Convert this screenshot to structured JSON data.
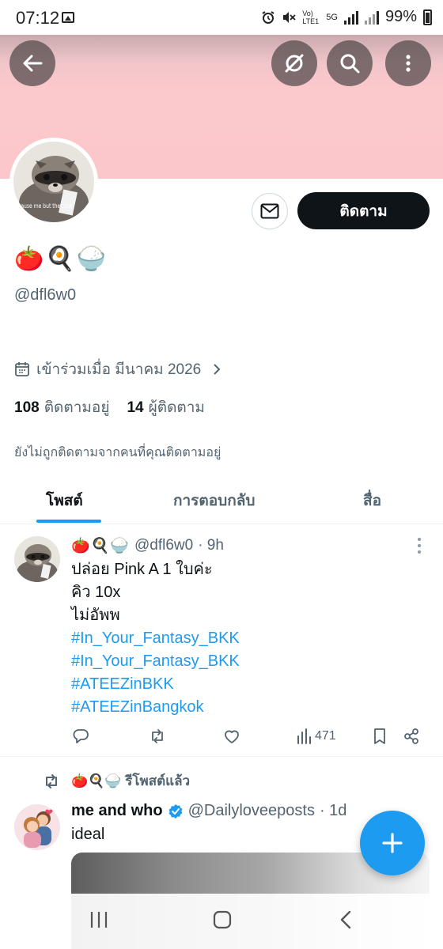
{
  "status_bar": {
    "time": "07:12",
    "network": "Vo) LTE1",
    "network_gen": "5G",
    "battery": "99%"
  },
  "profile": {
    "display_name": "🍅🍳🍚",
    "handle": "@dfl6w0",
    "joined": "เข้าร่วมเมื่อ มีนาคม 2026",
    "following_count": "108",
    "following_label": "ติดตามอยู่",
    "followers_count": "14",
    "followers_label": "ผู้ติดตาม",
    "not_followed_note": "ยังไม่ถูกติดตามจากคนที่คุณติดตามอยู่",
    "follow_button": "ติดตาม",
    "avatar_caption": "cause me but the fuck"
  },
  "tabs": [
    {
      "label": "โพสต์",
      "active": true
    },
    {
      "label": "การตอบกลับ",
      "active": false
    },
    {
      "label": "สื่อ",
      "active": false
    }
  ],
  "post": {
    "author": "🍅🍳🍚",
    "handle": "@dfl6w0",
    "time": "· 9h",
    "lines": [
      "ปล่อย Pink A 1 ใบค่ะ",
      "คิว 10x",
      "ไม่อัพพ"
    ],
    "hashtags": [
      "#In_Your_Fantasy_BKK",
      "#In_Your_Fantasy_BKK",
      "#ATEEZinBKK",
      "#ATEEZinBangkok"
    ],
    "views": "471"
  },
  "repost": {
    "label": "🍅🍳🍚 รีโพสต์แล้ว",
    "author": "me and who",
    "handle": "@Dailyloveeposts",
    "time": "· 1d",
    "text": "ideal"
  },
  "colors": {
    "accent": "#1d9bf0",
    "banner": "#fbc7cb",
    "text": "#0f1419",
    "muted": "#536471"
  }
}
